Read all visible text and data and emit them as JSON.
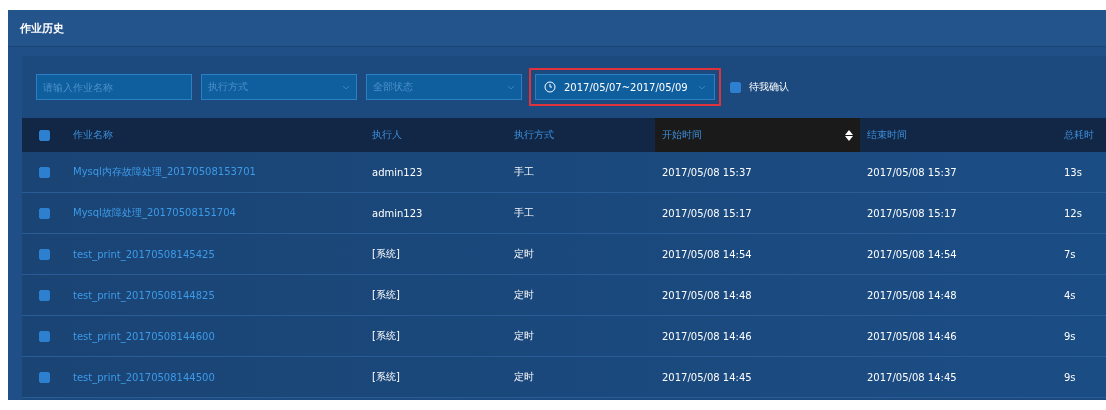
{
  "window": {
    "title": "作业历史"
  },
  "filters": {
    "search": {
      "placeholder": "请输入作业名称"
    },
    "selects": [
      {
        "value": "执行方式"
      },
      {
        "value": "全部状态"
      }
    ],
    "date_range": {
      "value": "2017/05/07~2017/05/09",
      "highlighted": true
    },
    "pending_checkbox": {
      "label": "待我确认",
      "checked": true
    }
  },
  "table": {
    "header_checked": true,
    "columns": [
      {
        "label": "作业名称",
        "sorted": false
      },
      {
        "label": "执行人",
        "sorted": false
      },
      {
        "label": "执行方式",
        "sorted": false
      },
      {
        "label": "开始时间",
        "sorted": true
      },
      {
        "label": "结束时间",
        "sorted": false
      },
      {
        "label": "总耗时",
        "sorted": false
      }
    ],
    "rows": [
      {
        "checked": true,
        "cells": [
          "Mysql内存故障处理_20170508153701",
          "admin123",
          "手工",
          "2017/05/08 15:37",
          "2017/05/08 15:37",
          "13s"
        ]
      },
      {
        "checked": true,
        "cells": [
          "Mysql故障处理_20170508151704",
          "admin123",
          "手工",
          "2017/05/08 15:17",
          "2017/05/08 15:17",
          "12s"
        ]
      },
      {
        "checked": true,
        "cells": [
          "test_print_20170508145425",
          "[系统]",
          "定时",
          "2017/05/08 14:54",
          "2017/05/08 14:54",
          "7s"
        ]
      },
      {
        "checked": true,
        "cells": [
          "test_print_20170508144825",
          "[系统]",
          "定时",
          "2017/05/08 14:48",
          "2017/05/08 14:48",
          "4s"
        ]
      },
      {
        "checked": true,
        "cells": [
          "test_print_20170508144600",
          "[系统]",
          "定时",
          "2017/05/08 14:46",
          "2017/05/08 14:46",
          "9s"
        ]
      },
      {
        "checked": true,
        "cells": [
          "test_print_20170508144500",
          "[系统]",
          "定时",
          "2017/05/08 14:45",
          "2017/05/08 14:45",
          "9s"
        ]
      }
    ]
  }
}
